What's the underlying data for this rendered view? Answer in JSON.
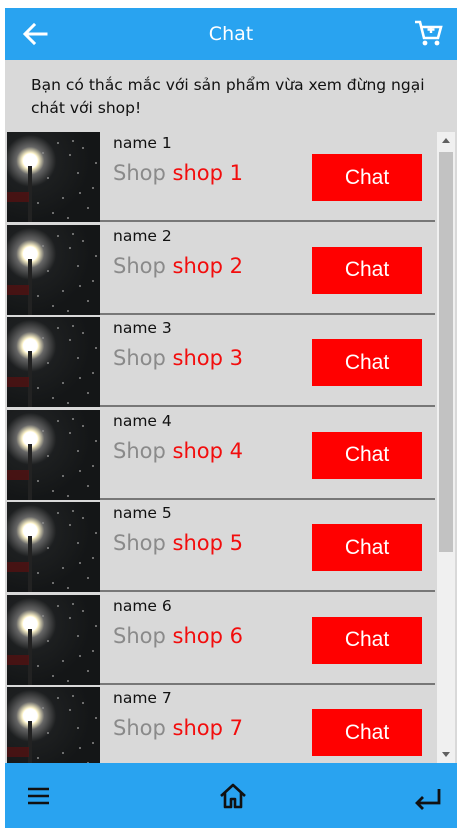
{
  "header": {
    "title": "Chat",
    "back_icon": "arrow-left-icon",
    "cart_icon": "shopping-cart-icon"
  },
  "notice": {
    "text": "Bạn có thắc mắc với sản phẩm vừa xem đừng ngại chát với shop!"
  },
  "shops": [
    {
      "name": "name 1",
      "shop_label": "Shop",
      "shop_value": "shop 1",
      "button": "Chat"
    },
    {
      "name": "name 2",
      "shop_label": "Shop",
      "shop_value": "shop 2",
      "button": "Chat"
    },
    {
      "name": "name 3",
      "shop_label": "Shop",
      "shop_value": "shop 3",
      "button": "Chat"
    },
    {
      "name": "name 4",
      "shop_label": "Shop",
      "shop_value": "shop 4",
      "button": "Chat"
    },
    {
      "name": "name 5",
      "shop_label": "Shop",
      "shop_value": "shop 5",
      "button": "Chat"
    },
    {
      "name": "name 6",
      "shop_label": "Shop",
      "shop_value": "shop 6",
      "button": "Chat"
    },
    {
      "name": "name 7",
      "shop_label": "Shop",
      "shop_value": "shop 7",
      "button": "Chat"
    }
  ],
  "footer": {
    "menu_icon": "hamburger-menu-icon",
    "home_icon": "home-icon",
    "return_icon": "return-icon"
  },
  "colors": {
    "bar": "#29a3f0",
    "accent": "#ff0000",
    "background": "#d9d9d9"
  }
}
